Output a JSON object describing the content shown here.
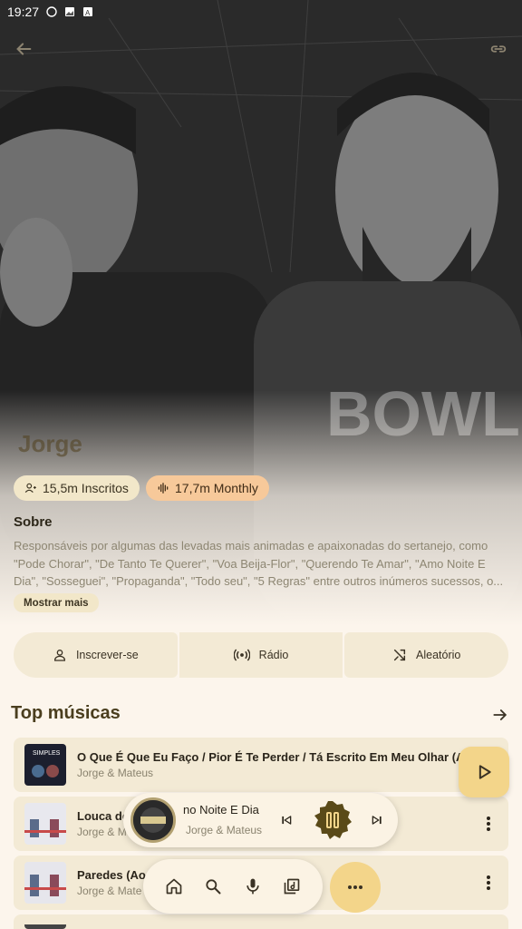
{
  "status_bar": {
    "time": "19:27",
    "icons": [
      "whatsapp-icon",
      "gallery-icon",
      "notification-icon"
    ]
  },
  "header": {
    "back_icon": "arrow-back-icon",
    "link_icon": "link-icon"
  },
  "artist": {
    "name": "Jorge",
    "subscribers": "15,5m Inscritos",
    "monthly": "17,7m Monthly"
  },
  "about": {
    "title": "Sobre",
    "text": "Responsáveis por algumas das levadas mais animadas e apaixonadas do sertanejo, como \"Pode Chorar\", \"De Tanto Te Querer\", \"Voa Beija-Flor\", \"Querendo Te Amar\", \"Amo Noite E Dia\", \"Sosseguei\", \"Propaganda\", \"Todo seu\", \"5 Regras\" entre outros inúmeros sucessos, o...",
    "more_label": "Mostrar mais"
  },
  "actions": [
    {
      "label": "Inscrever-se",
      "icon": "person-icon"
    },
    {
      "label": "Rádio",
      "icon": "radio-icon"
    },
    {
      "label": "Aleatório",
      "icon": "shuffle-icon"
    }
  ],
  "top_songs": {
    "title": "Top músicas",
    "tracks": [
      {
        "title": "O Que É Que Eu Faço / Pior É Te Perder / Tá Escrito Em Meu Olhar (A...",
        "artist": "Jorge & Mateus"
      },
      {
        "title": "Louca de",
        "artist": "Jorge & M"
      },
      {
        "title": "Paredes (Ao",
        "artist": "Jorge & Mate"
      }
    ]
  },
  "now_playing": {
    "title": "no Noite E Dia",
    "artist": "Jorge & Mateus"
  },
  "colors": {
    "background": "#fcf5ec",
    "accent": "#f3d58a",
    "chip_subs": "#f2e7c9",
    "chip_monthly": "#f7c99a",
    "pause_button": "#5a4a18"
  }
}
